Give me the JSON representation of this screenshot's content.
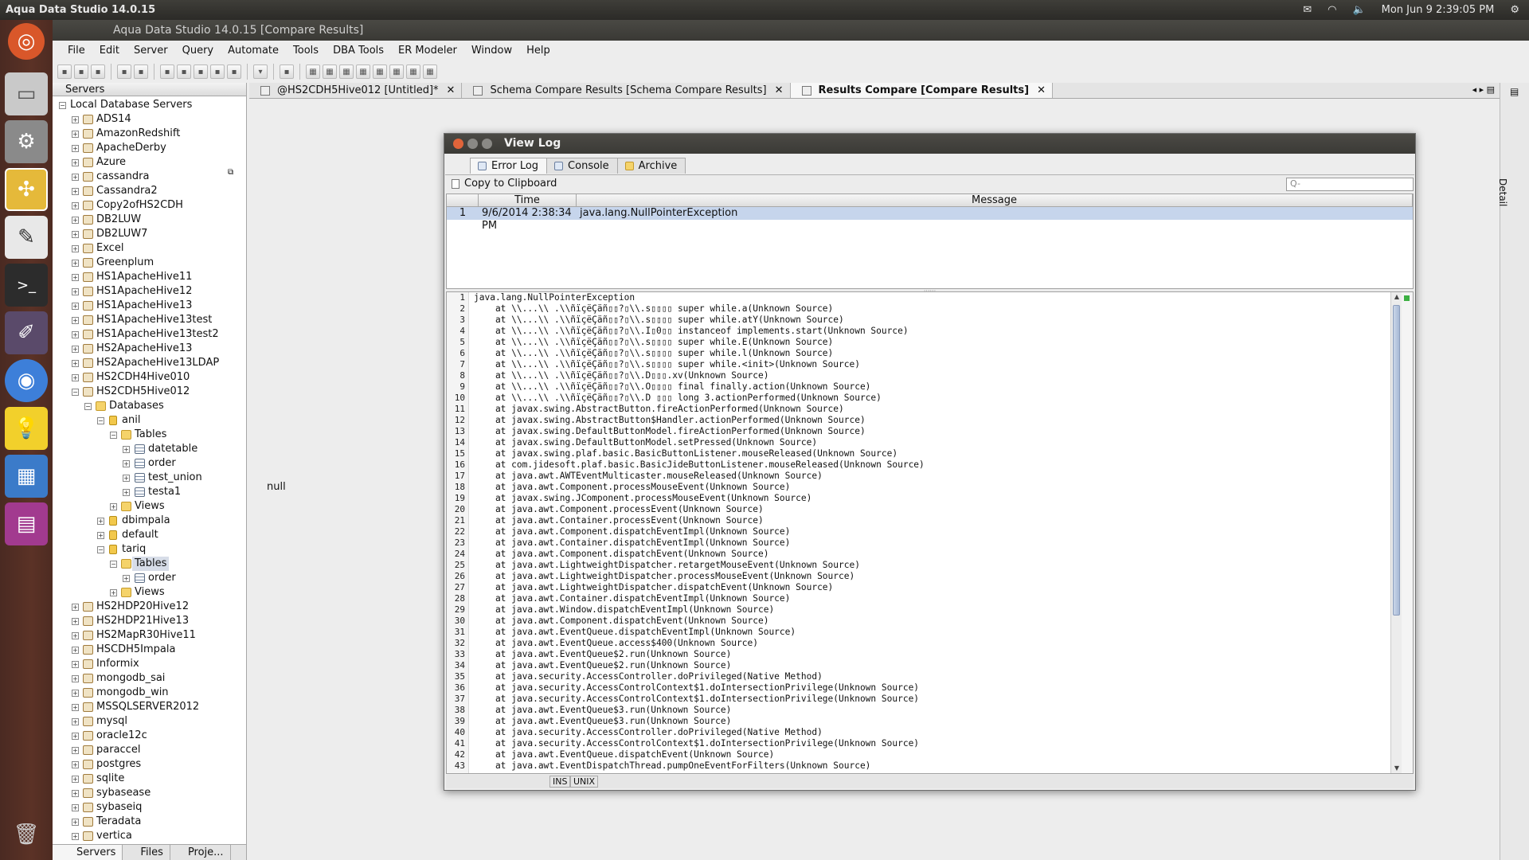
{
  "topbar": {
    "app_name": "Aqua Data Studio 14.0.15",
    "datetime": "Mon Jun 9   2:39:05 PM"
  },
  "window": {
    "title": "Aqua Data Studio 14.0.15 [Compare Results]"
  },
  "menubar": [
    "File",
    "Edit",
    "Server",
    "Query",
    "Automate",
    "Tools",
    "DBA Tools",
    "ER Modeler",
    "Window",
    "Help"
  ],
  "server_panel": {
    "title": "Servers",
    "root": "Local Database Servers",
    "servers_top": [
      "ADS14",
      "AmazonRedshift",
      "ApacheDerby",
      "Azure",
      "cassandra",
      "Cassandra2",
      "Copy2ofHS2CDH",
      "DB2LUW",
      "DB2LUW7",
      "Excel",
      "Greenplum",
      "HS1ApacheHive11",
      "HS1ApacheHive12",
      "HS1ApacheHive13",
      "HS1ApacheHive13test",
      "HS1ApacheHive13test2",
      "HS2ApacheHive13",
      "HS2ApacheHive13LDAP",
      "HS2CDH4Hive010",
      "HS2CDH5Hive012"
    ],
    "databases_label": "Databases",
    "db_anil": "anil",
    "tables_label": "Tables",
    "anil_tables": [
      "datetable",
      "order",
      "test_union",
      "testa1"
    ],
    "views_label": "Views",
    "db_dbimpala": "dbimpala",
    "db_default": "default",
    "db_tariq": "tariq",
    "tariq_tables": [
      "order"
    ],
    "servers_bottom": [
      "HS2HDP20Hive12",
      "HS2HDP21Hive13",
      "HS2MapR30Hive11",
      "HSCDH5Impala",
      "Informix",
      "mongodb_sai",
      "mongodb_win",
      "MSSQLSERVER2012",
      "mysql",
      "oracle12c",
      "paraccel",
      "postgres",
      "sqlite",
      "sybasease",
      "sybaseiq",
      "Teradata",
      "vertica"
    ],
    "bottom_tabs": [
      "Servers",
      "Files",
      "Proje..."
    ]
  },
  "editor_tabs": [
    {
      "label": "@HS2CDH5Hive012 [Untitled]*",
      "active": false
    },
    {
      "label": "Schema Compare Results [Schema Compare Results]",
      "active": false
    },
    {
      "label": "Results Compare [Compare Results]",
      "active": true
    }
  ],
  "content_null": "null",
  "right_strip_label": "Detail",
  "dialog": {
    "title": "View Log",
    "tabs": [
      "Error Log",
      "Console",
      "Archive"
    ],
    "copy_label": "Copy to Clipboard",
    "search_placeholder": "Q-",
    "columns": [
      "",
      "Time",
      "Message"
    ],
    "rows": [
      {
        "num": "1",
        "time": "9/6/2014 2:38:34 PM",
        "message": "java.lang.NullPointerException"
      }
    ],
    "log_lines": [
      "java.lang.NullPointerException",
      "    at \\\\...\\\\ .\\\\ñïçëÇäñ▯▯?▯\\\\.s▯▯▯▯ super while.a(Unknown Source)",
      "    at \\\\...\\\\ .\\\\ñïçëÇäñ▯▯?▯\\\\.s▯▯▯▯ super while.atY(Unknown Source)",
      "    at \\\\...\\\\ .\\\\ñïçëÇäñ▯▯?▯\\\\.I▯0▯▯ instanceof implements.start(Unknown Source)",
      "    at \\\\...\\\\ .\\\\ñïçëÇäñ▯▯?▯\\\\.s▯▯▯▯ super while.E(Unknown Source)",
      "    at \\\\...\\\\ .\\\\ñïçëÇäñ▯▯?▯\\\\.s▯▯▯▯ super while.l(Unknown Source)",
      "    at \\\\...\\\\ .\\\\ñïçëÇäñ▯▯?▯\\\\.s▯▯▯▯ super while.<init>(Unknown Source)",
      "    at \\\\...\\\\ .\\\\ñïçëÇäñ▯▯?▯\\\\.D▯▯▯.xv(Unknown Source)",
      "    at \\\\...\\\\ .\\\\ñïçëÇäñ▯▯?▯\\\\.O▯▯▯▯ final finally.action(Unknown Source)",
      "    at \\\\...\\\\ .\\\\ñïçëÇäñ▯▯?▯\\\\.D ▯▯▯ long 3.actionPerformed(Unknown Source)",
      "    at javax.swing.AbstractButton.fireActionPerformed(Unknown Source)",
      "    at javax.swing.AbstractButton$Handler.actionPerformed(Unknown Source)",
      "    at javax.swing.DefaultButtonModel.fireActionPerformed(Unknown Source)",
      "    at javax.swing.DefaultButtonModel.setPressed(Unknown Source)",
      "    at javax.swing.plaf.basic.BasicButtonListener.mouseReleased(Unknown Source)",
      "    at com.jidesoft.plaf.basic.BasicJideButtonListener.mouseReleased(Unknown Source)",
      "    at java.awt.AWTEventMulticaster.mouseReleased(Unknown Source)",
      "    at java.awt.Component.processMouseEvent(Unknown Source)",
      "    at javax.swing.JComponent.processMouseEvent(Unknown Source)",
      "    at java.awt.Component.processEvent(Unknown Source)",
      "    at java.awt.Container.processEvent(Unknown Source)",
      "    at java.awt.Component.dispatchEventImpl(Unknown Source)",
      "    at java.awt.Container.dispatchEventImpl(Unknown Source)",
      "    at java.awt.Component.dispatchEvent(Unknown Source)",
      "    at java.awt.LightweightDispatcher.retargetMouseEvent(Unknown Source)",
      "    at java.awt.LightweightDispatcher.processMouseEvent(Unknown Source)",
      "    at java.awt.LightweightDispatcher.dispatchEvent(Unknown Source)",
      "    at java.awt.Container.dispatchEventImpl(Unknown Source)",
      "    at java.awt.Window.dispatchEventImpl(Unknown Source)",
      "    at java.awt.Component.dispatchEvent(Unknown Source)",
      "    at java.awt.EventQueue.dispatchEventImpl(Unknown Source)",
      "    at java.awt.EventQueue.access$400(Unknown Source)",
      "    at java.awt.EventQueue$2.run(Unknown Source)",
      "    at java.awt.EventQueue$2.run(Unknown Source)",
      "    at java.security.AccessController.doPrivileged(Native Method)",
      "    at java.security.AccessControlContext$1.doIntersectionPrivilege(Unknown Source)",
      "    at java.security.AccessControlContext$1.doIntersectionPrivilege(Unknown Source)",
      "    at java.awt.EventQueue$3.run(Unknown Source)",
      "    at java.awt.EventQueue$3.run(Unknown Source)",
      "    at java.security.AccessController.doPrivileged(Native Method)",
      "    at java.security.AccessControlContext$1.doIntersectionPrivilege(Unknown Source)",
      "    at java.awt.EventQueue.dispatchEvent(Unknown Source)",
      "    at java.awt.EventDispatchThread.pumpOneEventForFilters(Unknown Source)"
    ],
    "status": [
      "INS",
      "UNIX"
    ]
  }
}
